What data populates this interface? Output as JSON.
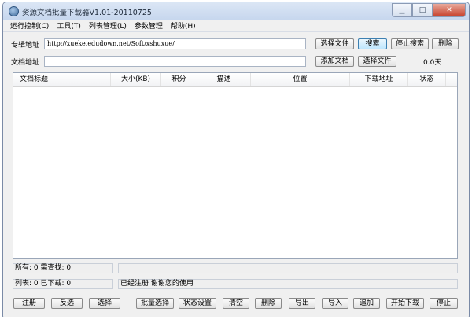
{
  "window": {
    "title": "资源文档批量下载器V1.01-20110725",
    "controls": {
      "minimize": "▁",
      "maximize": "□",
      "close": "✕"
    }
  },
  "menu": {
    "items": [
      "运行控制(C)",
      "工具(T)",
      "列表管理(L)",
      "参数管理",
      "帮助(H)"
    ]
  },
  "form": {
    "album_label": "专辑地址",
    "album_url": "http://xueke.edudown.net/Soft/xshuxue/",
    "doc_label": "文档地址",
    "doc_url": "",
    "row1_buttons": {
      "choose_file": "选择文件",
      "search": "搜索",
      "stop_search": "停止搜索",
      "delete": "删除"
    },
    "row2_buttons": {
      "add_doc": "添加文档",
      "choose_file": "选择文件"
    },
    "days": "0.0天"
  },
  "table": {
    "columns": [
      "文档标题",
      "大小(KB)",
      "积分",
      "描述",
      "位置",
      "下载地址",
      "状态"
    ],
    "rows": []
  },
  "status": {
    "all_text": "所有: 0 需查找: 0",
    "list_text": "列表: 0 已下载: 0",
    "reg_text": "已经注册 谢谢您的使用",
    "progress": ""
  },
  "bottom_buttons": [
    "注册",
    "反选",
    "选择",
    "批量选择",
    "状态设置",
    "清空",
    "删除",
    "导出",
    "导入",
    "追加",
    "开始下载",
    "停止"
  ],
  "colors": {
    "focused_button": "#bee6fd",
    "close_button": "#c7412c"
  }
}
